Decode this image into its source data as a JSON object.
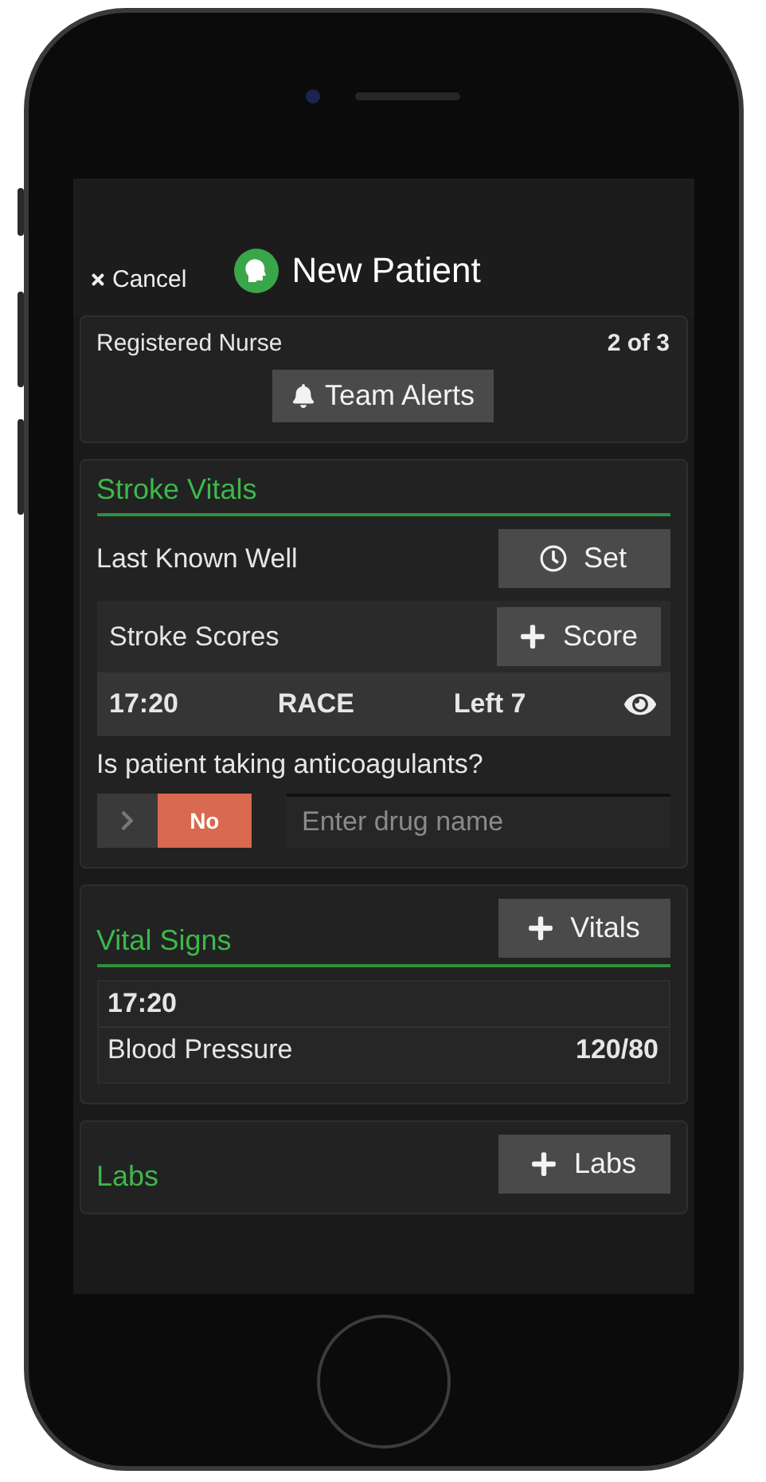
{
  "header": {
    "cancel": "Cancel",
    "title": "New Patient"
  },
  "team_card": {
    "role": "Registered Nurse",
    "count": "2 of 3",
    "alerts_button": "Team Alerts"
  },
  "stroke_vitals": {
    "title": "Stroke Vitals",
    "last_known_well": {
      "label": "Last Known Well",
      "button": "Set"
    },
    "scores": {
      "label": "Stroke Scores",
      "button": "Score",
      "rows": [
        {
          "time": "17:20",
          "scale": "RACE",
          "result": "Left 7"
        }
      ]
    },
    "anticoagulants": {
      "question": "Is patient taking anticoagulants?",
      "toggle": {
        "on": false,
        "label": "No"
      },
      "drug_field": {
        "placeholder": "Enter drug name"
      }
    }
  },
  "vital_signs": {
    "title": "Vital Signs",
    "button": "Vitals",
    "entries": [
      {
        "time": "17:20",
        "name": "Blood Pressure",
        "value": "120/80"
      }
    ]
  },
  "labs": {
    "title": "Labs",
    "button": "Labs"
  }
}
